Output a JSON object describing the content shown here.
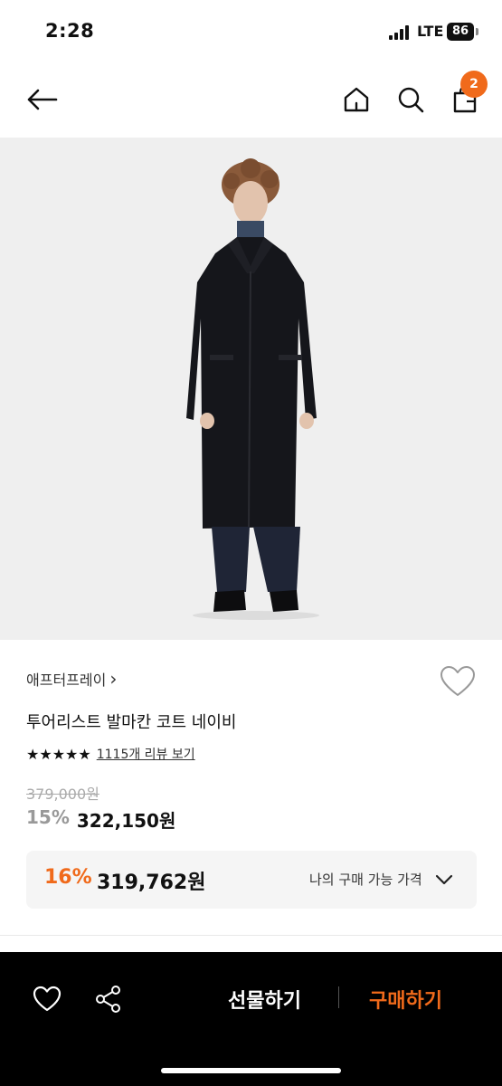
{
  "status_bar": {
    "time": "2:28",
    "network": "LTE",
    "battery": "86"
  },
  "nav": {
    "cart_count": "2",
    "icons": [
      "back-arrow-icon",
      "home-icon",
      "search-icon",
      "shopping-bag-icon"
    ]
  },
  "product": {
    "brand": "애프터프레이",
    "brand_chevron": "›",
    "title": "투어리스트 발마칸 코트 네이비",
    "rating_stars": "★★★★★",
    "review_text": "1115개 리뷰 보기",
    "original_price": "379,000원",
    "discount_rate": "15%",
    "sale_price": "322,150원"
  },
  "member_price": {
    "discount_rate": "16%",
    "price": "319,762원",
    "label": "나의 구매 가능 가격"
  },
  "bottom_bar": {
    "gift_label": "선물하기",
    "buy_label": "구매하기"
  },
  "colors": {
    "accent": "#f06a1b",
    "bottom_bar_bg": "#000000",
    "image_bg": "#efefef"
  }
}
